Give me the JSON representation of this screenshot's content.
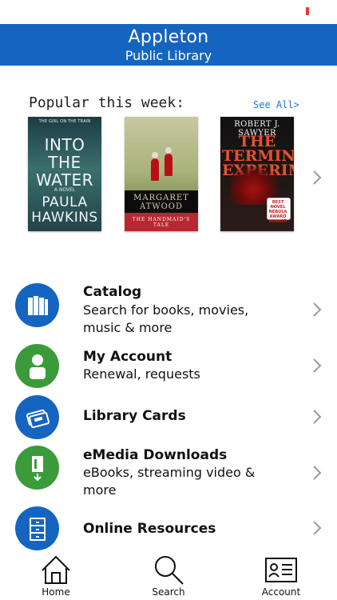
{
  "header": {
    "title_line1": "Appleton",
    "title_line2": "Public Library"
  },
  "popular": {
    "heading": "Popular this week:",
    "see_all": "See All>",
    "books": [
      {
        "publisher_line": "THE GIRL ON THE TRAIN",
        "title": "INTO THE WATER",
        "subtitle": "A NOVEL",
        "author": "PAULA HAWKINS"
      },
      {
        "author": "MARGARET ATWOOD",
        "title": "THE HANDMAID'S TALE"
      },
      {
        "author": "ROBERT J. SAWYER",
        "title": "THE TERMINAL EXPERIMENT",
        "badge": "BEST NOVEL NEBULA AWARD WINNER"
      }
    ]
  },
  "menu": [
    {
      "title": "Catalog",
      "subtitle": "Search for books, movies, music & more",
      "icon": "books-icon",
      "color": "#1565c0"
    },
    {
      "title": "My Account",
      "subtitle": "Renewal, requests",
      "icon": "person-icon",
      "color": "#3a9b3a"
    },
    {
      "title": "Library Cards",
      "subtitle": "",
      "icon": "library-card-icon",
      "color": "#1565c0"
    },
    {
      "title": "eMedia Downloads",
      "subtitle": "eBooks, streaming video & more",
      "icon": "download-book-icon",
      "color": "#3a9b3a"
    },
    {
      "title": "Online Resources",
      "subtitle": "",
      "icon": "file-cabinet-icon",
      "color": "#1565c0"
    }
  ],
  "tabs": [
    {
      "label": "Home",
      "icon": "home-icon"
    },
    {
      "label": "Search",
      "icon": "search-icon"
    },
    {
      "label": "Account",
      "icon": "account-card-icon"
    }
  ],
  "colors": {
    "brand_blue": "#1565c0",
    "green": "#3a9b3a",
    "link_blue": "#1e74d8",
    "status_red": "#e53935"
  }
}
